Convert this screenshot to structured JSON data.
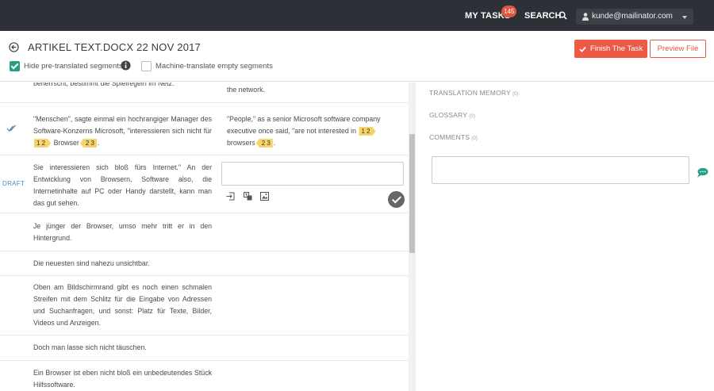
{
  "topbar": {
    "my_tasks_label": "MY TASKS",
    "tasks_count": "145",
    "search_label": "SEARCH",
    "user_email": "kunde@mailinator.com"
  },
  "header": {
    "title": "ARTIKEL TEXT.DOCX 22 NOV 2017",
    "hide_pretranslated_label": "Hide pre-translated segments",
    "hide_pretranslated_checked": true,
    "machine_translate_label": "Machine-translate empty segments",
    "machine_translate_checked": false,
    "finish_button": "Finish The Task",
    "preview_button": "Preview File"
  },
  "segments": {
    "row0": {
      "source": "beherrscht, bestimmt die Spielregeln im Netz.",
      "target": "the network."
    },
    "row1": {
      "source_a": "\"Menschen\", sagte einmal ein hochrangiger Manager des Software-Konzerns Microsoft, \"interessieren sich nicht für ",
      "source_b": " Browser",
      "source_c": ".",
      "target_a": "\"People,\" as a senior Microsoft software company executive once said, \"are not interested in ",
      "target_b": " browsers",
      "target_c": ".",
      "tag1": "1 2",
      "tag2": "2 3"
    },
    "row2": {
      "status": "DRAFT",
      "source": "Sie interessieren sich bloß fürs Internet.\" An der Entwicklung von Browsern, Software also, die Internetinhalte auf PC oder Handy darstellt, kann man das gut sehen."
    },
    "row3": {
      "source": "Je jünger der Browser, umso mehr tritt er in den Hintergrund."
    },
    "row4": {
      "source": "Die neuesten sind nahezu unsichtbar."
    },
    "row5": {
      "source": "Oben am Bildschirmrand gibt es noch einen schmalen Streifen mit dem Schlitz für die Eingabe von Adressen und Suchanfragen, und sonst: Platz für Texte, Bilder, Videos und Anzeigen."
    },
    "row6": {
      "source": "Doch man lasse sich nicht täuschen."
    },
    "row7": {
      "source": "Ein Browser ist eben nicht bloß ein unbedeutendes Stück Hilfssoftware."
    }
  },
  "sidebar": {
    "translation_memory_label": "TRANSLATION MEMORY",
    "translation_memory_count": "(0)",
    "glossary_label": "GLOSSARY",
    "glossary_count": "(0)",
    "comments_label": "COMMENTS",
    "comments_count": "(0)"
  },
  "colors": {
    "topbar": "#2e3038",
    "accent": "#ec5a45",
    "check": "#25a084",
    "tag": "#f6d36b",
    "draft": "#4a8ec2",
    "comment_icon": "#25a084"
  }
}
